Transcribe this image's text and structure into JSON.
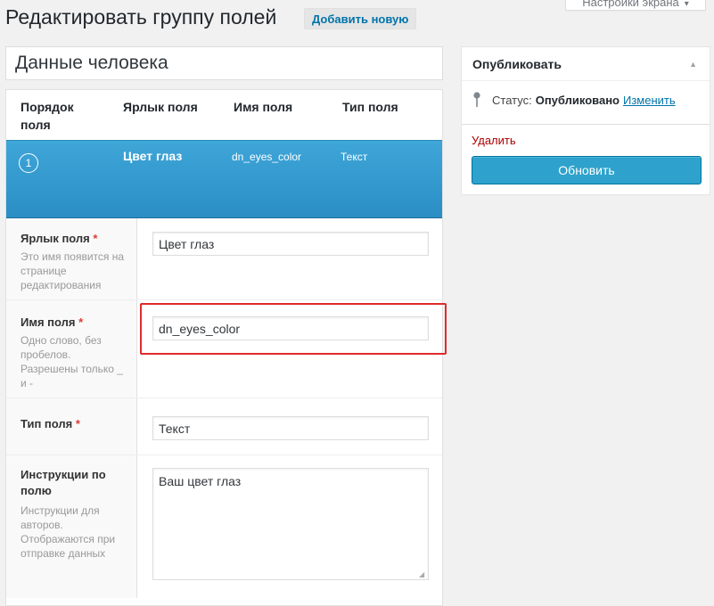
{
  "header": {
    "screen_options": "Настройки экрана",
    "title": "Редактировать группу полей",
    "add_new": "Добавить новую"
  },
  "group_title": "Данные человека",
  "fields_table": {
    "columns": {
      "order": "Порядок поля",
      "label": "Ярлык поля",
      "name": "Имя поля",
      "type": "Тип поля"
    },
    "row": {
      "order": "1",
      "label": "Цвет глаз",
      "name": "dn_eyes_color",
      "type": "Текст"
    }
  },
  "settings": {
    "label": {
      "title": "Ярлык поля",
      "required": "*",
      "desc": "Это имя появится на странице редактирования",
      "value": "Цвет глаз"
    },
    "name": {
      "title": "Имя поля",
      "required": "*",
      "desc": "Одно слово, без пробелов. Разрешены только _ и -",
      "value": "dn_eyes_color"
    },
    "type": {
      "title": "Тип поля",
      "required": "*",
      "value": "Текст"
    },
    "instructions": {
      "title": "Инструкции по полю",
      "desc": "Инструкции для авторов. Отображаются при отправке данных",
      "value": "Ваш цвет глаз"
    }
  },
  "publish": {
    "title": "Опубликовать",
    "status_label": "Статус:",
    "status_value": "Опубликовано",
    "edit_link": "Изменить",
    "delete": "Удалить",
    "update": "Обновить"
  },
  "colors": {
    "row_accent": "#2a8ec5",
    "highlight": "#e02b2b",
    "update_button": "#2ea2cc",
    "delete_link": "#aa0000"
  }
}
